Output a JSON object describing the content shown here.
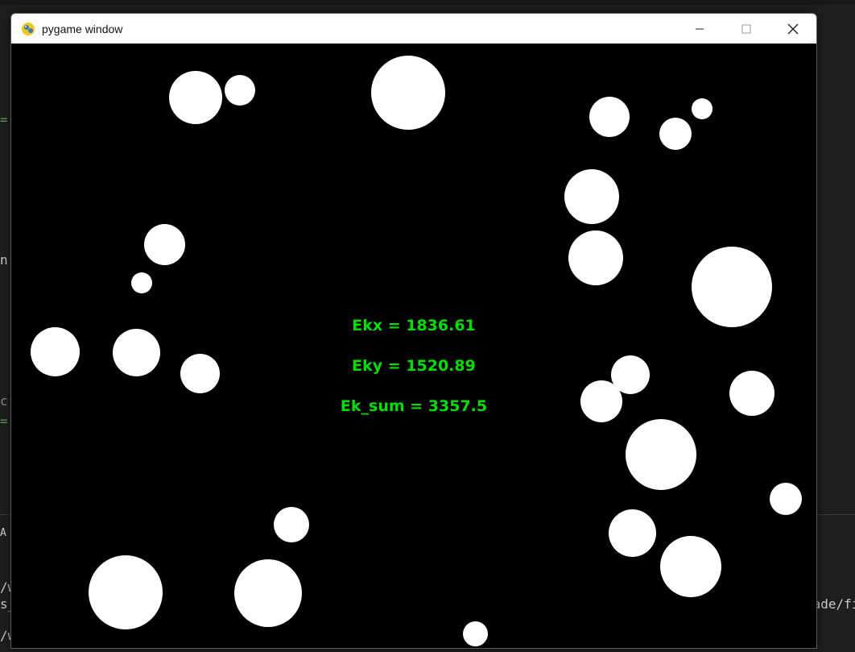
{
  "window": {
    "title": "pygame window",
    "icon": "pygame-snake-icon",
    "controls": {
      "minimize": "minimize-icon",
      "maximize": "maximize-icon",
      "close": "close-icon"
    }
  },
  "hud": {
    "ekx": "Ekx = 1836.61",
    "eky": "Eky = 1520.89",
    "ek_sum": "Ek_sum = 3357.5",
    "color": "#00e000"
  },
  "background": {
    "fragments": [
      "=",
      "n",
      "c",
      "=",
      "A",
      "/w",
      "s_",
      "/w",
      "lade/fi"
    ]
  },
  "colors": {
    "ball": "#ffffff",
    "canvas": "#000000",
    "titlebar": "#ffffff"
  }
}
